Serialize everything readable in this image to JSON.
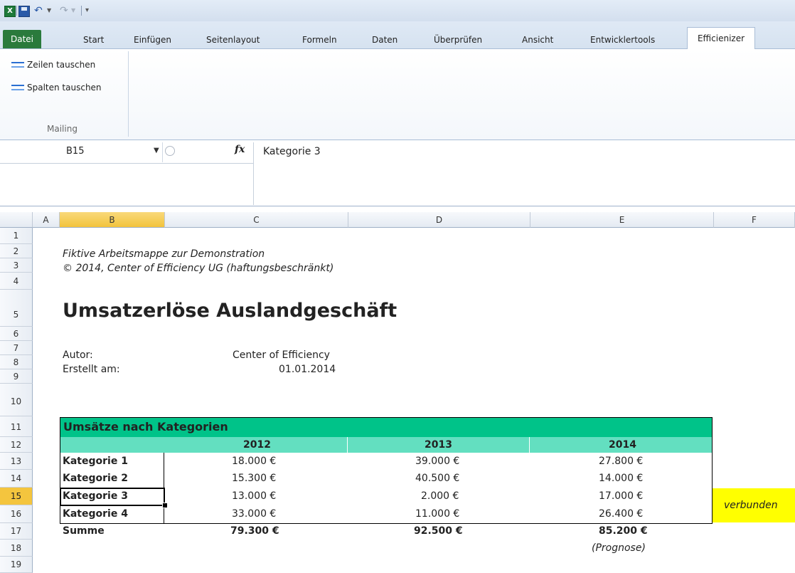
{
  "qat": {
    "app_logo": "X"
  },
  "tabs": {
    "datei": "Datei",
    "items": [
      "Start",
      "Einfügen",
      "Seitenlayout",
      "Formeln",
      "Daten",
      "Überprüfen",
      "Ansicht",
      "Entwicklertools"
    ],
    "active": "Efficienizer"
  },
  "ribbon": {
    "buttons": [
      "Zeilen tauschen",
      "Spalten tauschen"
    ],
    "group_label": "Mailing"
  },
  "formula_bar": {
    "name_box": "B15",
    "fx": "fx",
    "formula": "Kategorie 3"
  },
  "grid": {
    "columns": [
      "A",
      "B",
      "C",
      "D",
      "E",
      "F"
    ],
    "selected_column": "B",
    "rows": [
      "1",
      "2",
      "3",
      "4",
      "5",
      "6",
      "7",
      "8",
      "9",
      "10",
      "11",
      "12",
      "13",
      "14",
      "15",
      "16",
      "17",
      "18",
      "19"
    ],
    "selected_row": "15"
  },
  "sheet": {
    "subtitle1": "Fiktive Arbeitsmappe zur Demonstration",
    "subtitle2": "© 2014, Center of Efficiency UG (haftungsbeschränkt)",
    "title": "Umsatzerlöse Auslandgeschäft",
    "author_label": "Autor:",
    "author_value": "Center of Efficiency",
    "created_label": "Erstellt am:",
    "created_value": "01.01.2014",
    "table": {
      "title": "Umsätze nach Kategorien",
      "years": [
        "2012",
        "2013",
        "2014"
      ],
      "rows": [
        {
          "label": "Kategorie 1",
          "values": [
            "18.000 €",
            "39.000 €",
            "27.800 €"
          ]
        },
        {
          "label": "Kategorie 2",
          "values": [
            "15.300 €",
            "40.500 €",
            "14.000 €"
          ]
        },
        {
          "label": "Kategorie 3",
          "values": [
            "13.000 €",
            "2.000 €",
            "17.000 €"
          ]
        },
        {
          "label": "Kategorie 4",
          "values": [
            "33.000 €",
            "11.000 €",
            "26.400 €"
          ]
        }
      ],
      "sum_label": "Summe",
      "sums": [
        "79.300 €",
        "92.500 €",
        "85.200 €"
      ],
      "forecast_note": "(Prognose)"
    },
    "merged_note": "verbunden",
    "colors": {
      "table_title": "#00c389",
      "table_header": "#63dfc0",
      "merged_note": "#ffff00"
    }
  }
}
